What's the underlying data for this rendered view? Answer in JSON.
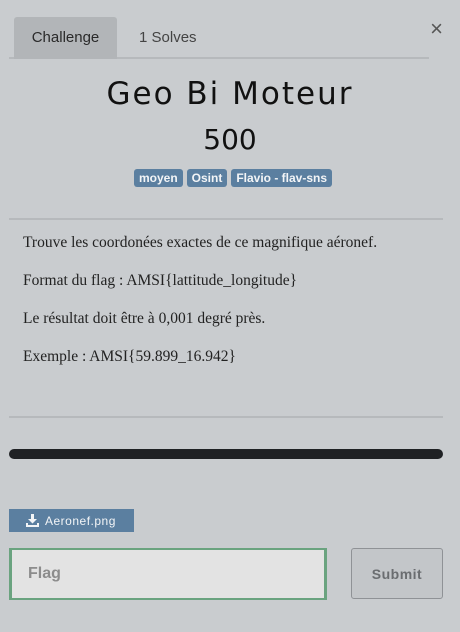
{
  "tabs": [
    {
      "label": "Challenge",
      "active": true
    },
    {
      "label": "1 Solves",
      "active": false
    }
  ],
  "close_icon": "×",
  "challenge": {
    "name": "Geo Bi Moteur",
    "value": "500",
    "tags": [
      "moyen",
      "Osint",
      "Flavio - flav-sns"
    ],
    "description": [
      "Trouve les coordonées exactes de ce magnifique aéronef.",
      "Format du flag : AMSI{lattitude_longitude}",
      "Le résultat doit être à 0,001 degré près.",
      "Exemple : AMSI{59.899_16.942}"
    ]
  },
  "file": {
    "label": "Aeronef.png",
    "icon": "download-icon"
  },
  "form": {
    "placeholder": "Flag",
    "submit_label": "Submit"
  },
  "colors": {
    "tag": "#5b7fa0",
    "input_border": "#6aa37f",
    "progress_bar": "#1f2124",
    "background": "#c9cccf"
  }
}
